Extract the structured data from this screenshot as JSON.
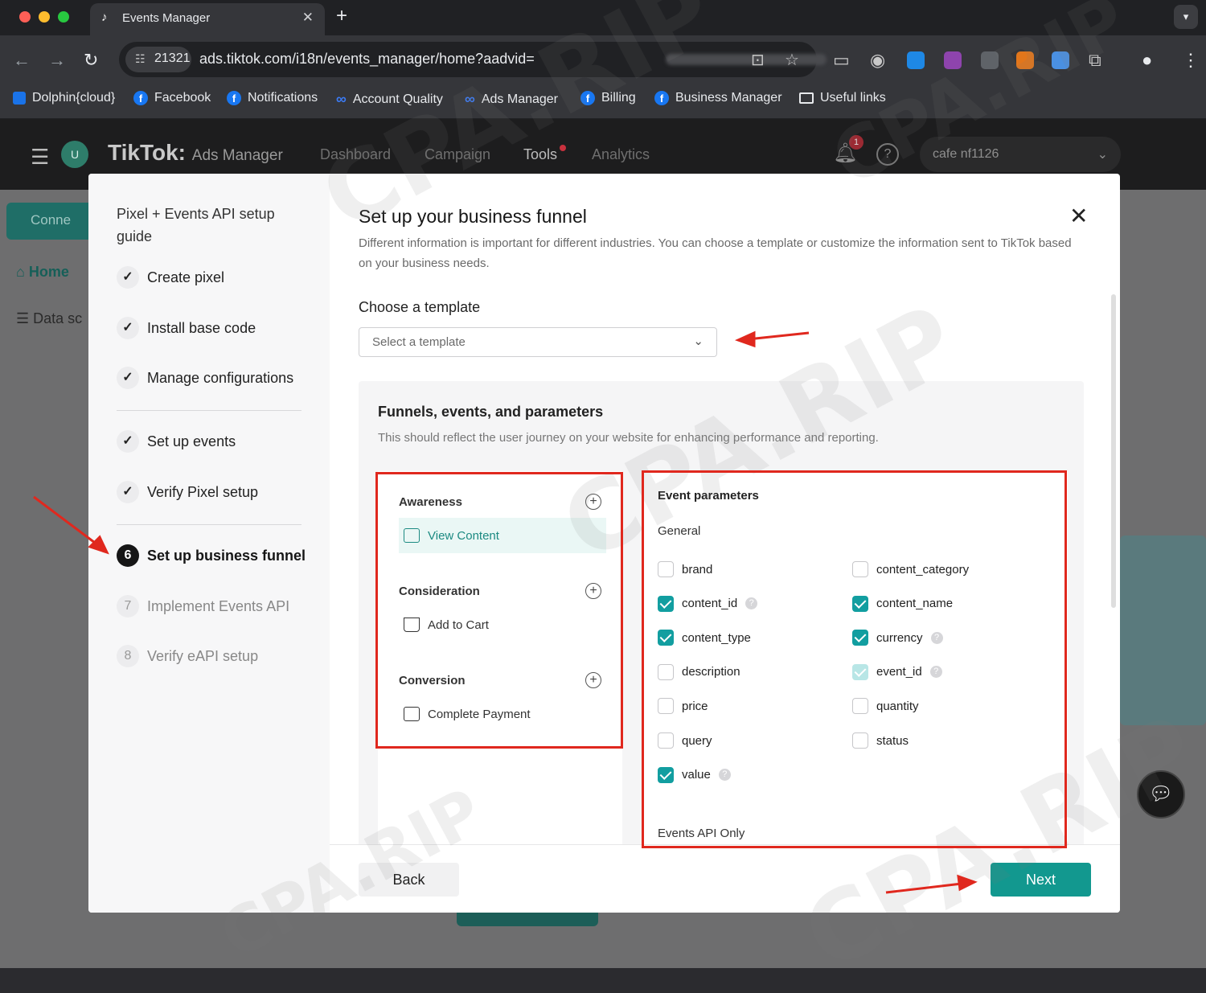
{
  "browser": {
    "tab_title": "Events Manager",
    "tab_close": "✕",
    "new_tab": "+",
    "site_badge": "21321",
    "url": "ads.tiktok.com/i18n/events_manager/home?aadvid=",
    "bookmarks": [
      "Dolphin{cloud}",
      "Facebook",
      "Notifications",
      "Account Quality",
      "Ads Manager",
      "Billing",
      "Business Manager",
      "Useful links"
    ]
  },
  "app": {
    "avatar": "U",
    "brand": "TikTok",
    "brand_sub": "Ads Manager",
    "nav": [
      "Dashboard",
      "Campaign",
      "Tools",
      "Analytics"
    ],
    "notification_count": "1",
    "account": "cafe nf1126",
    "sidebar": {
      "connect": "Conne",
      "home": "Home",
      "data": "Data sc"
    }
  },
  "guide": {
    "title": "Pixel + Events API setup guide",
    "steps": [
      {
        "label": "Create pixel",
        "mark": "✓"
      },
      {
        "label": "Install base code",
        "mark": "✓"
      },
      {
        "label": "Manage configurations",
        "mark": "✓"
      },
      {
        "label": "Set up events",
        "mark": "✓"
      },
      {
        "label": "Verify Pixel setup",
        "mark": "✓"
      },
      {
        "label": "Set up business funnel",
        "mark": "6"
      },
      {
        "label": "Implement Events API",
        "mark": "7"
      },
      {
        "label": "Verify eAPI setup",
        "mark": "8"
      }
    ]
  },
  "modal": {
    "title": "Set up your business funnel",
    "description": "Different information is important for different industries. You can choose a template or customize the information sent to TikTok based on your business needs.",
    "template_label": "Choose a template",
    "template_placeholder": "Select a template",
    "funnel_title": "Funnels, events, and parameters",
    "funnel_sub": "This should reflect the user journey on your website for enhancing performance and reporting.",
    "stages": [
      {
        "name": "Awareness",
        "event": "View Content"
      },
      {
        "name": "Consideration",
        "event": "Add to Cart"
      },
      {
        "name": "Conversion",
        "event": "Complete Payment"
      }
    ],
    "params_title": "Event parameters",
    "general_label": "General",
    "params": [
      {
        "name": "brand",
        "state": "off"
      },
      {
        "name": "content_category",
        "state": "off"
      },
      {
        "name": "content_id",
        "state": "on",
        "help": true
      },
      {
        "name": "content_name",
        "state": "on"
      },
      {
        "name": "content_type",
        "state": "on"
      },
      {
        "name": "currency",
        "state": "on",
        "help": true
      },
      {
        "name": "description",
        "state": "off"
      },
      {
        "name": "event_id",
        "state": "locked",
        "help": true
      },
      {
        "name": "price",
        "state": "off"
      },
      {
        "name": "quantity",
        "state": "off"
      },
      {
        "name": "query",
        "state": "off"
      },
      {
        "name": "status",
        "state": "off"
      },
      {
        "name": "value",
        "state": "on",
        "help": true
      }
    ],
    "events_api_only": "Events API Only",
    "back": "Back",
    "next": "Next",
    "close": "✕"
  },
  "watermark": "CPA.RIP",
  "colors": {
    "accent": "#12988f",
    "annotation": "#e0281e"
  }
}
